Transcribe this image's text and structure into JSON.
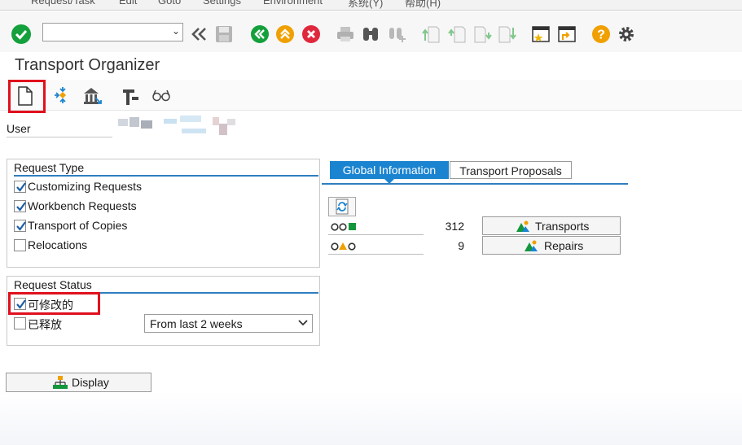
{
  "menubar": {
    "items": [
      "Request/Task",
      "Edit",
      "Goto",
      "Settings",
      "Environment",
      "系统(Y)",
      "帮助(H)"
    ]
  },
  "toolbar": {
    "command_value": ""
  },
  "page": {
    "title": "Transport Organizer"
  },
  "user": {
    "label": "User"
  },
  "request_type": {
    "title": "Request Type",
    "items": [
      {
        "label": "Customizing Requests",
        "checked": true
      },
      {
        "label": "Workbench Requests",
        "checked": true
      },
      {
        "label": "Transport of Copies",
        "checked": true
      },
      {
        "label": "Relocations",
        "checked": false
      }
    ]
  },
  "request_status": {
    "title": "Request Status",
    "items": [
      {
        "label": "可修改的",
        "checked": true
      },
      {
        "label": "已释放",
        "checked": false
      }
    ],
    "period_selected": "From last 2 weeks"
  },
  "tabs": [
    {
      "label": "Global Information",
      "active": true
    },
    {
      "label": "Transport Proposals",
      "active": false
    }
  ],
  "global_info": {
    "transports_count": "312",
    "transports_label": "Transports",
    "repairs_count": "9",
    "repairs_label": "Repairs"
  },
  "display_button": {
    "label": "Display"
  },
  "colors": {
    "accent": "#1b84d0",
    "highlight": "#e0101e",
    "ok_green": "#14a03c",
    "cancel_red": "#e0283c",
    "help_orange": "#f0a000"
  }
}
